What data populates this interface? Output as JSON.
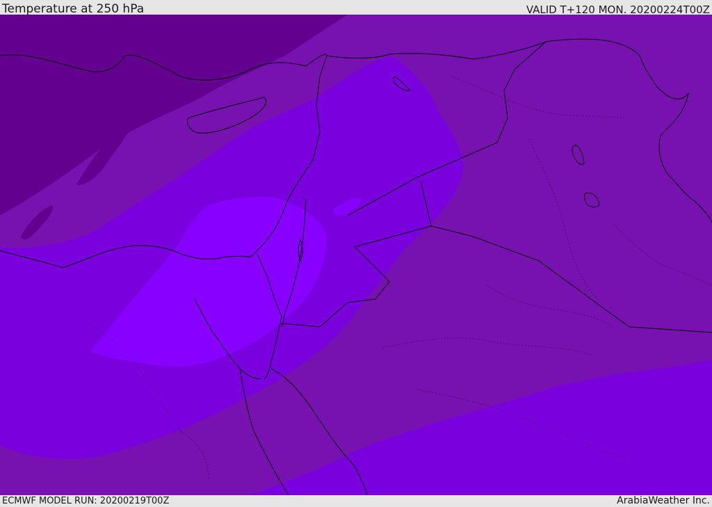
{
  "header": {
    "title": "Temperature at 250 hPa",
    "valid": "VALID T+120 MON. 20200224T00Z"
  },
  "footer": {
    "model_run": "ECMWF MODEL RUN: 20200219T00Z",
    "credit": "ArabiaWeather Inc."
  },
  "map": {
    "colors": {
      "darkest": "#64008f",
      "dark": "#7712b0",
      "medium": "#7a00dd",
      "light": "#8800ff",
      "lightest": "#7f00ff",
      "coastline": "#000000"
    }
  }
}
